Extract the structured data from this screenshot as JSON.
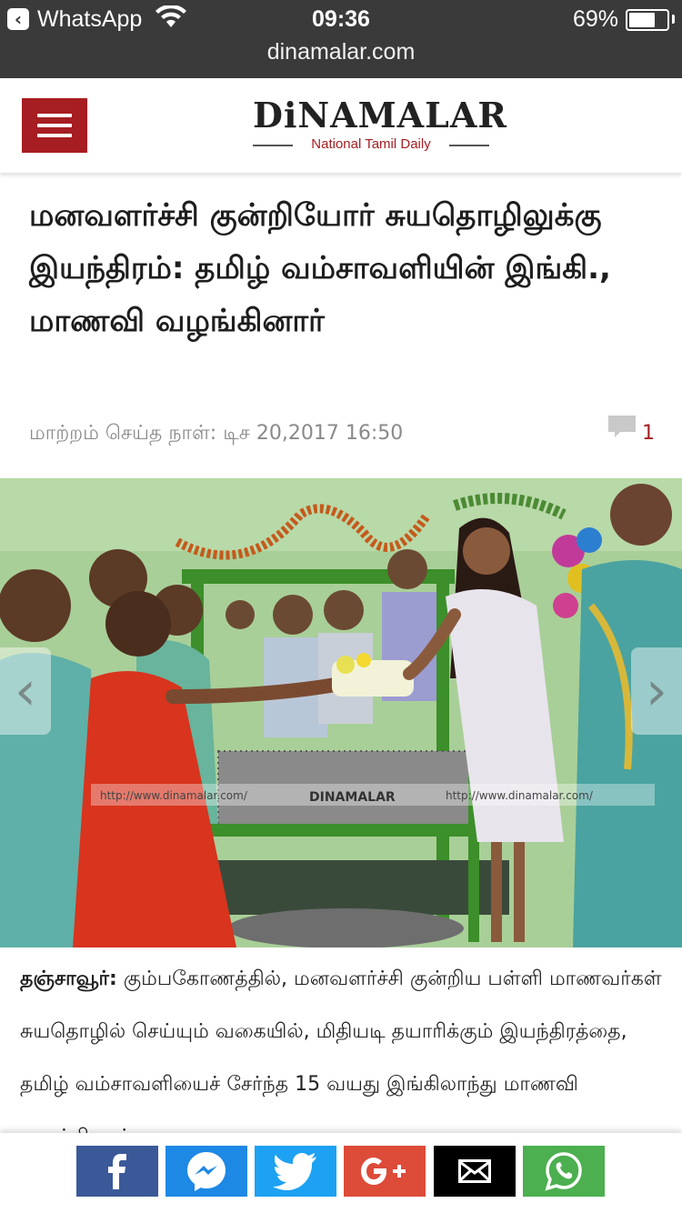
{
  "status_bar": {
    "back_app": "WhatsApp",
    "time": "09:36",
    "battery_percent": "69%",
    "battery_level": 0.69,
    "url": "dinamalar.com"
  },
  "header": {
    "logo_title": "DiNAMALAR",
    "logo_subtitle": "National Tamil Daily"
  },
  "article": {
    "headline": "மனவளர்ச்சி குன்றியோர் சுயதொழிலுக்கு இயந்திரம்: தமிழ் வம்சாவளியின் இங்கி., மாணவி வழங்கினார்",
    "updated": "மாற்றம் செய்த நாள்: டிச 20,2017 16:50",
    "comment_count": "1",
    "photo_watermarks": [
      "http://www.dinamalar.com/",
      "DINAMALAR",
      "http://www.dinamalar.com/"
    ],
    "body_place": "தஞ்சாவூர்:",
    "body_text": "கும்பகோணத்தில், மனவளர்ச்சி குன்றிய பள்ளி மாணவர்கள் சுயதொழில் செய்யும் வகையில், மிதியடி தயாரிக்கும் இயந்திரத்தை, தமிழ் வம்சாவளியைச் சேர்ந்த 15 வயது இங்கிலாந்து மாணவி வழங்கினார்."
  },
  "gallery": {
    "prev_symbol": "‹",
    "next_symbol": "›"
  },
  "share": [
    {
      "icon": "facebook-icon",
      "color": "#3b5998"
    },
    {
      "icon": "messenger-icon",
      "color": "#1e88e5"
    },
    {
      "icon": "twitter-icon",
      "color": "#1da1f2"
    },
    {
      "icon": "google-plus-icon",
      "color": "#dd4b39"
    },
    {
      "icon": "mail-icon",
      "color": "#000000"
    },
    {
      "icon": "whatsapp-icon",
      "color": "#4caf50"
    }
  ]
}
